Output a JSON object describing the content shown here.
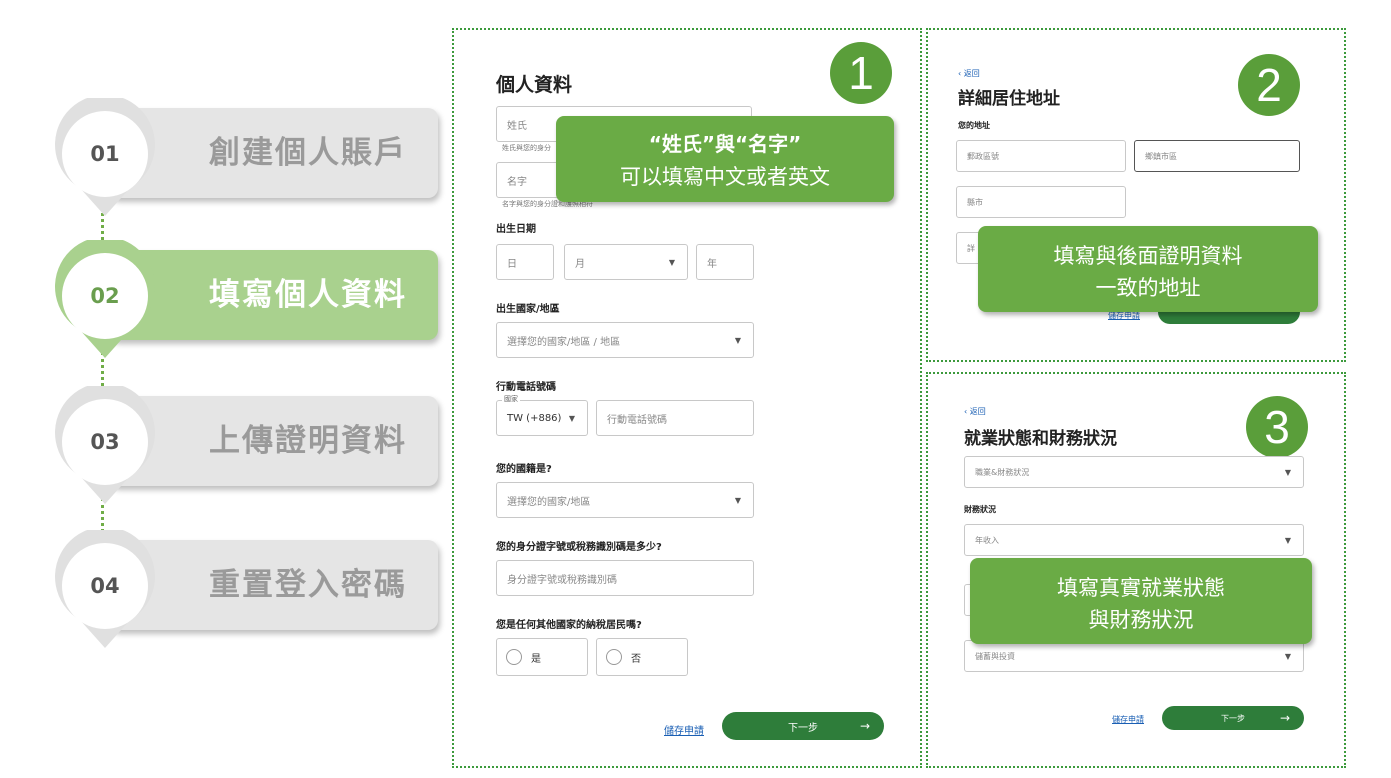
{
  "colors": {
    "accent_green": "#6aab45",
    "badge_green": "#5a9e3a",
    "active_step": "#a9d18e",
    "inactive_step": "#e5e5e5",
    "button_green": "#2e7d3a",
    "link_blue": "#1a5fb4"
  },
  "steps": [
    {
      "num": "01",
      "label": "創建個人賬戶",
      "active": false
    },
    {
      "num": "02",
      "label": "填寫個人資料",
      "active": true
    },
    {
      "num": "03",
      "label": "上傳證明資料",
      "active": false
    },
    {
      "num": "04",
      "label": "重置登入密碼",
      "active": false
    }
  ],
  "panel1": {
    "badge": "1",
    "title": "個人資料",
    "last_name_ph": "姓氏",
    "last_name_hint": "姓氏與您的身分",
    "first_name_ph": "名字",
    "first_name_hint": "名字與您的身分證和護照相符",
    "dob_label": "出生日期",
    "dob_day": "日",
    "dob_month": "月",
    "dob_year": "年",
    "birth_country_label": "出生國家/地區",
    "birth_country_ph": "選擇您的國家/地區 / 地區",
    "phone_label": "行動電話號碼",
    "country_code_label": "國家",
    "country_code_value": "TW (+886)",
    "phone_ph": "行動電話號碼",
    "nationality_label": "您的國籍是?",
    "nationality_ph": "選擇您的國家/地區",
    "id_label": "您的身分證字號或稅務識別碼是多少?",
    "id_ph": "身分證字號或稅務識別碼",
    "tax_label": "您是任何其他國家的納稅居民嗎?",
    "yes": "是",
    "no": "否",
    "save_link": "儲存申請",
    "next_button": "下一步",
    "callout_line1": "“姓氏”與“名字”",
    "callout_line2": "可以填寫中文或者英文"
  },
  "panel2": {
    "badge": "2",
    "back": "‹ 返回",
    "title": "詳細居住地址",
    "address_label": "您的地址",
    "postal_ph": "郵政區號",
    "district_ph": "鄉鎮市區",
    "city_ph": "縣市",
    "detail_ph": "詳",
    "save_link": "儲存申請",
    "callout_line1": "填寫與後面證明資料",
    "callout_line2": "一致的地址"
  },
  "panel3": {
    "badge": "3",
    "back": "‹ 返回",
    "title": "就業狀態和財務狀況",
    "employment_ph": "職業&財務狀況",
    "finance_label": "財務狀況",
    "income_ph": "年收入",
    "savings_ph": "儲蓄與投資",
    "save_link": "儲存申請",
    "next_button": "下一步",
    "callout_line1": "填寫真實就業狀態",
    "callout_line2": "與財務狀況"
  }
}
